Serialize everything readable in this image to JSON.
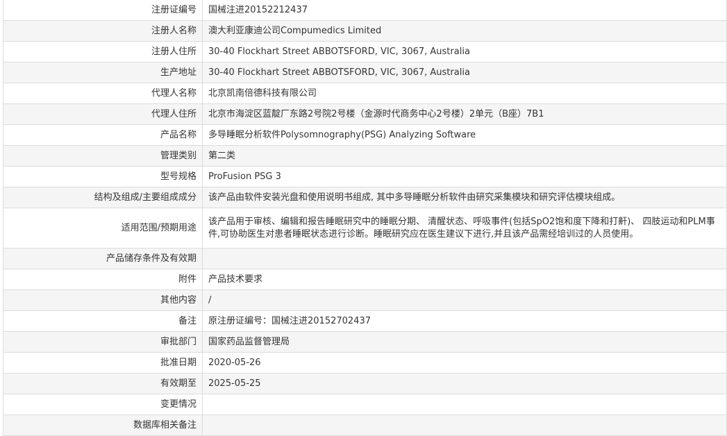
{
  "rows": [
    {
      "label": "注册证编号",
      "value": "国械注进20152212437"
    },
    {
      "label": "注册人名称",
      "value": "澳大利亚康迪公司Compumedics Limited"
    },
    {
      "label": "注册人住所",
      "value": "30-40 Flockhart Street ABBOTSFORD, VIC, 3067, Australia"
    },
    {
      "label": "生产地址",
      "value": "30-40 Flockhart Street ABBOTSFORD, VIC, 3067, Australia"
    },
    {
      "label": "代理人名称",
      "value": "北京凯南倍德科技有限公司"
    },
    {
      "label": "代理人住所",
      "value": "北京市海淀区蓝靛厂东路2号院2号楼（金源时代商务中心2号楼）2单元（B座）7B1"
    },
    {
      "label": "产品名称",
      "value": "多导睡眠分析软件Polysomnography(PSG) Analyzing Software"
    },
    {
      "label": "管理类别",
      "value": "第二类"
    },
    {
      "label": "型号规格",
      "value": "ProFusion PSG 3"
    },
    {
      "label": "结构及组成/主要组成成分",
      "value": "该产品由软件安装光盘和使用说明书组成, 其中多导睡眠分析软件由研究采集模块和研究评估模块组成。"
    },
    {
      "label": "适用范围/预期用途",
      "value": "该产品用于审核、编辑和报告睡眠研究中的睡眠分期、 清醒状态、呼吸事件(包括SpO2饱和度下降和打鼾)、 四肢运动和PLM事件,可协助医生对患者睡眠状态进行诊断。睡眠研究应在医生建议下进行,并且该产品需经培训过的人员使用。"
    },
    {
      "label": "产品储存条件及有效期",
      "value": ""
    },
    {
      "label": "附件",
      "value": "产品技术要求"
    },
    {
      "label": "其他内容",
      "value": "/"
    },
    {
      "label": "备注",
      "value": "原注册证编号：国械注进20152702437"
    },
    {
      "label": "审批部门",
      "value": "国家药品监督管理局"
    },
    {
      "label": "批准日期",
      "value": "2020-05-26"
    },
    {
      "label": "有效期至",
      "value": "2025-05-25"
    },
    {
      "label": "变更情况",
      "value": ""
    },
    {
      "label": "数据库相关备注",
      "value": ""
    }
  ]
}
